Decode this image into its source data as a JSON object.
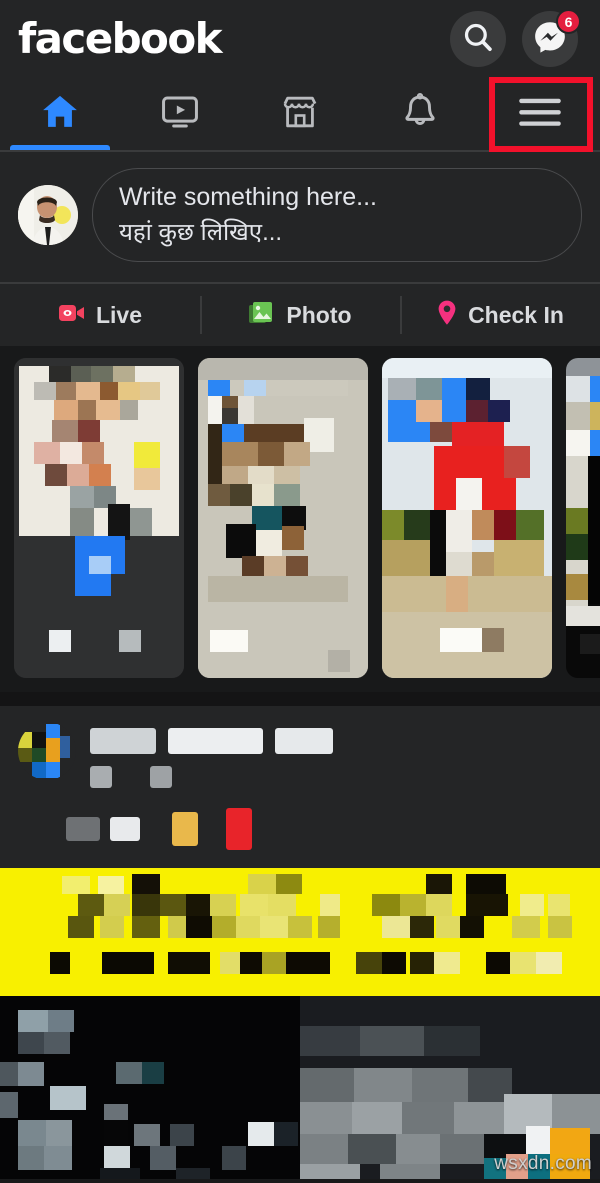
{
  "app": {
    "name": "facebook",
    "theme": "dark",
    "background_color": "#18191a",
    "surface_color": "#242526",
    "accent_color": "#2e89ff",
    "watermark": "wsxdn.com"
  },
  "header": {
    "wordmark": "facebook",
    "actions": [
      {
        "name": "search-icon",
        "label": "Search",
        "badge": ""
      },
      {
        "name": "messenger-icon",
        "label": "Messenger",
        "badge": "6",
        "badge_color": "#e41e3f"
      }
    ]
  },
  "navtabs": {
    "active_index": 0,
    "highlight_index": 4,
    "highlight_color": "#f2112b",
    "items": [
      {
        "icon": "home-icon",
        "label": "Home",
        "active": true
      },
      {
        "icon": "video-icon",
        "label": "Watch",
        "active": false
      },
      {
        "icon": "marketplace-icon",
        "label": "Marketplace",
        "active": false
      },
      {
        "icon": "bell-icon",
        "label": "Notifications",
        "active": false
      },
      {
        "icon": "hamburger-menu-icon",
        "label": "Menu",
        "active": false
      }
    ]
  },
  "composer": {
    "avatar_alt": "User profile photo",
    "placeholder_en": "Write something here...",
    "placeholder_hi": "यहां कुछ लिखिए...",
    "actions": [
      {
        "icon": "live-video-icon",
        "label": "Live",
        "color": "#f3425f"
      },
      {
        "icon": "photo-icon",
        "label": "Photo",
        "color": "#6ac453"
      },
      {
        "icon": "location-pin-icon",
        "label": "Check In",
        "color": "#f5317f"
      }
    ]
  },
  "stories": {
    "items": [
      {
        "name": "story-card-1",
        "censored": true
      },
      {
        "name": "story-card-2",
        "censored": true
      },
      {
        "name": "story-card-3",
        "censored": true
      },
      {
        "name": "story-card-4",
        "censored": true
      }
    ]
  },
  "post": {
    "author_redacted": true,
    "timestamp_redacted": true,
    "banner_color": "#f8f000",
    "banner_text_redacted": true,
    "media_redacted": true
  }
}
